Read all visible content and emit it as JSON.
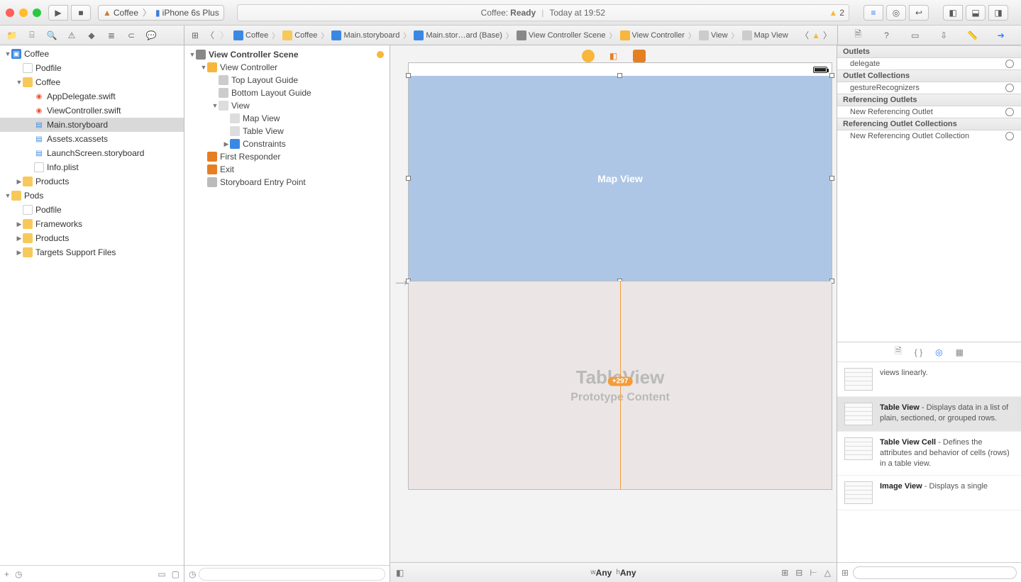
{
  "titlebar": {
    "scheme_app": "Coffee",
    "scheme_device": "iPhone 6s Plus",
    "status_app": "Coffee:",
    "status_state": "Ready",
    "status_time": "Today at 19:52",
    "warning_count": "2"
  },
  "breadcrumb": [
    {
      "label": "Coffee",
      "icon": "proj"
    },
    {
      "label": "Coffee",
      "icon": "folder"
    },
    {
      "label": "Main.storyboard",
      "icon": "sb"
    },
    {
      "label": "Main.stor…ard (Base)",
      "icon": "sb"
    },
    {
      "label": "View Controller Scene",
      "icon": "scene"
    },
    {
      "label": "View Controller",
      "icon": "vc"
    },
    {
      "label": "View",
      "icon": "view"
    },
    {
      "label": "Map View",
      "icon": "view"
    }
  ],
  "navigator": {
    "items": [
      {
        "indent": 0,
        "disc": "▼",
        "icon": "proj",
        "label": "Coffee"
      },
      {
        "indent": 1,
        "disc": "",
        "icon": "file",
        "label": "Podfile"
      },
      {
        "indent": 1,
        "disc": "▼",
        "icon": "folder",
        "label": "Coffee"
      },
      {
        "indent": 2,
        "disc": "",
        "icon": "swift",
        "label": "AppDelegate.swift"
      },
      {
        "indent": 2,
        "disc": "",
        "icon": "swift",
        "label": "ViewController.swift"
      },
      {
        "indent": 2,
        "disc": "",
        "icon": "sb",
        "label": "Main.storyboard",
        "selected": true
      },
      {
        "indent": 2,
        "disc": "",
        "icon": "assets",
        "label": "Assets.xcassets"
      },
      {
        "indent": 2,
        "disc": "",
        "icon": "sb",
        "label": "LaunchScreen.storyboard"
      },
      {
        "indent": 2,
        "disc": "",
        "icon": "file",
        "label": "Info.plist"
      },
      {
        "indent": 1,
        "disc": "▶",
        "icon": "folder",
        "label": "Products"
      },
      {
        "indent": 0,
        "disc": "▼",
        "icon": "folder",
        "label": "Pods"
      },
      {
        "indent": 1,
        "disc": "",
        "icon": "file",
        "label": "Podfile"
      },
      {
        "indent": 1,
        "disc": "▶",
        "icon": "folder",
        "label": "Frameworks"
      },
      {
        "indent": 1,
        "disc": "▶",
        "icon": "folder",
        "label": "Products"
      },
      {
        "indent": 1,
        "disc": "▶",
        "icon": "folder",
        "label": "Targets Support Files"
      }
    ]
  },
  "outline": {
    "items": [
      {
        "indent": 0,
        "disc": "▼",
        "icon": "scene",
        "label": "View Controller Scene",
        "bold": true,
        "warn": true
      },
      {
        "indent": 1,
        "disc": "▼",
        "icon": "vc",
        "label": "View Controller"
      },
      {
        "indent": 2,
        "disc": "",
        "icon": "guide",
        "label": "Top Layout Guide"
      },
      {
        "indent": 2,
        "disc": "",
        "icon": "guide",
        "label": "Bottom Layout Guide"
      },
      {
        "indent": 2,
        "disc": "▼",
        "icon": "view",
        "label": "View"
      },
      {
        "indent": 3,
        "disc": "",
        "icon": "view",
        "label": "Map View"
      },
      {
        "indent": 3,
        "disc": "",
        "icon": "view",
        "label": "Table View"
      },
      {
        "indent": 3,
        "disc": "▶",
        "icon": "constraints",
        "label": "Constraints"
      },
      {
        "indent": 1,
        "disc": "",
        "icon": "responder",
        "label": "First Responder"
      },
      {
        "indent": 1,
        "disc": "",
        "icon": "exit",
        "label": "Exit"
      },
      {
        "indent": 1,
        "disc": "",
        "icon": "entry",
        "label": "Storyboard Entry Point"
      }
    ]
  },
  "canvas": {
    "map_label": "Map View",
    "table_title": "TableView",
    "table_subtitle": "Prototype Content",
    "constraint_badge": "+297",
    "sizeclass_w_prefix": "w",
    "sizeclass_w": "Any",
    "sizeclass_h_prefix": "h",
    "sizeclass_h": "Any"
  },
  "inspector": {
    "sections": {
      "outlets_h": "Outlets",
      "outlets_item": "delegate",
      "outlet_coll_h": "Outlet Collections",
      "outlet_coll_item": "gestureRecognizers",
      "ref_outlets_h": "Referencing Outlets",
      "ref_outlets_item": "New Referencing Outlet",
      "ref_outlet_coll_h": "Referencing Outlet Collections",
      "ref_outlet_coll_item": "New Referencing Outlet Collection"
    },
    "library": [
      {
        "title": "",
        "body": "views linearly."
      },
      {
        "title": "Table View",
        "body": " - Displays data in a list of plain, sectioned, or grouped rows.",
        "selected": true
      },
      {
        "title": "Table View Cell",
        "body": " - Defines the attributes and behavior of cells (rows) in a table view."
      },
      {
        "title": "Image View",
        "body": " - Displays a single"
      }
    ]
  }
}
